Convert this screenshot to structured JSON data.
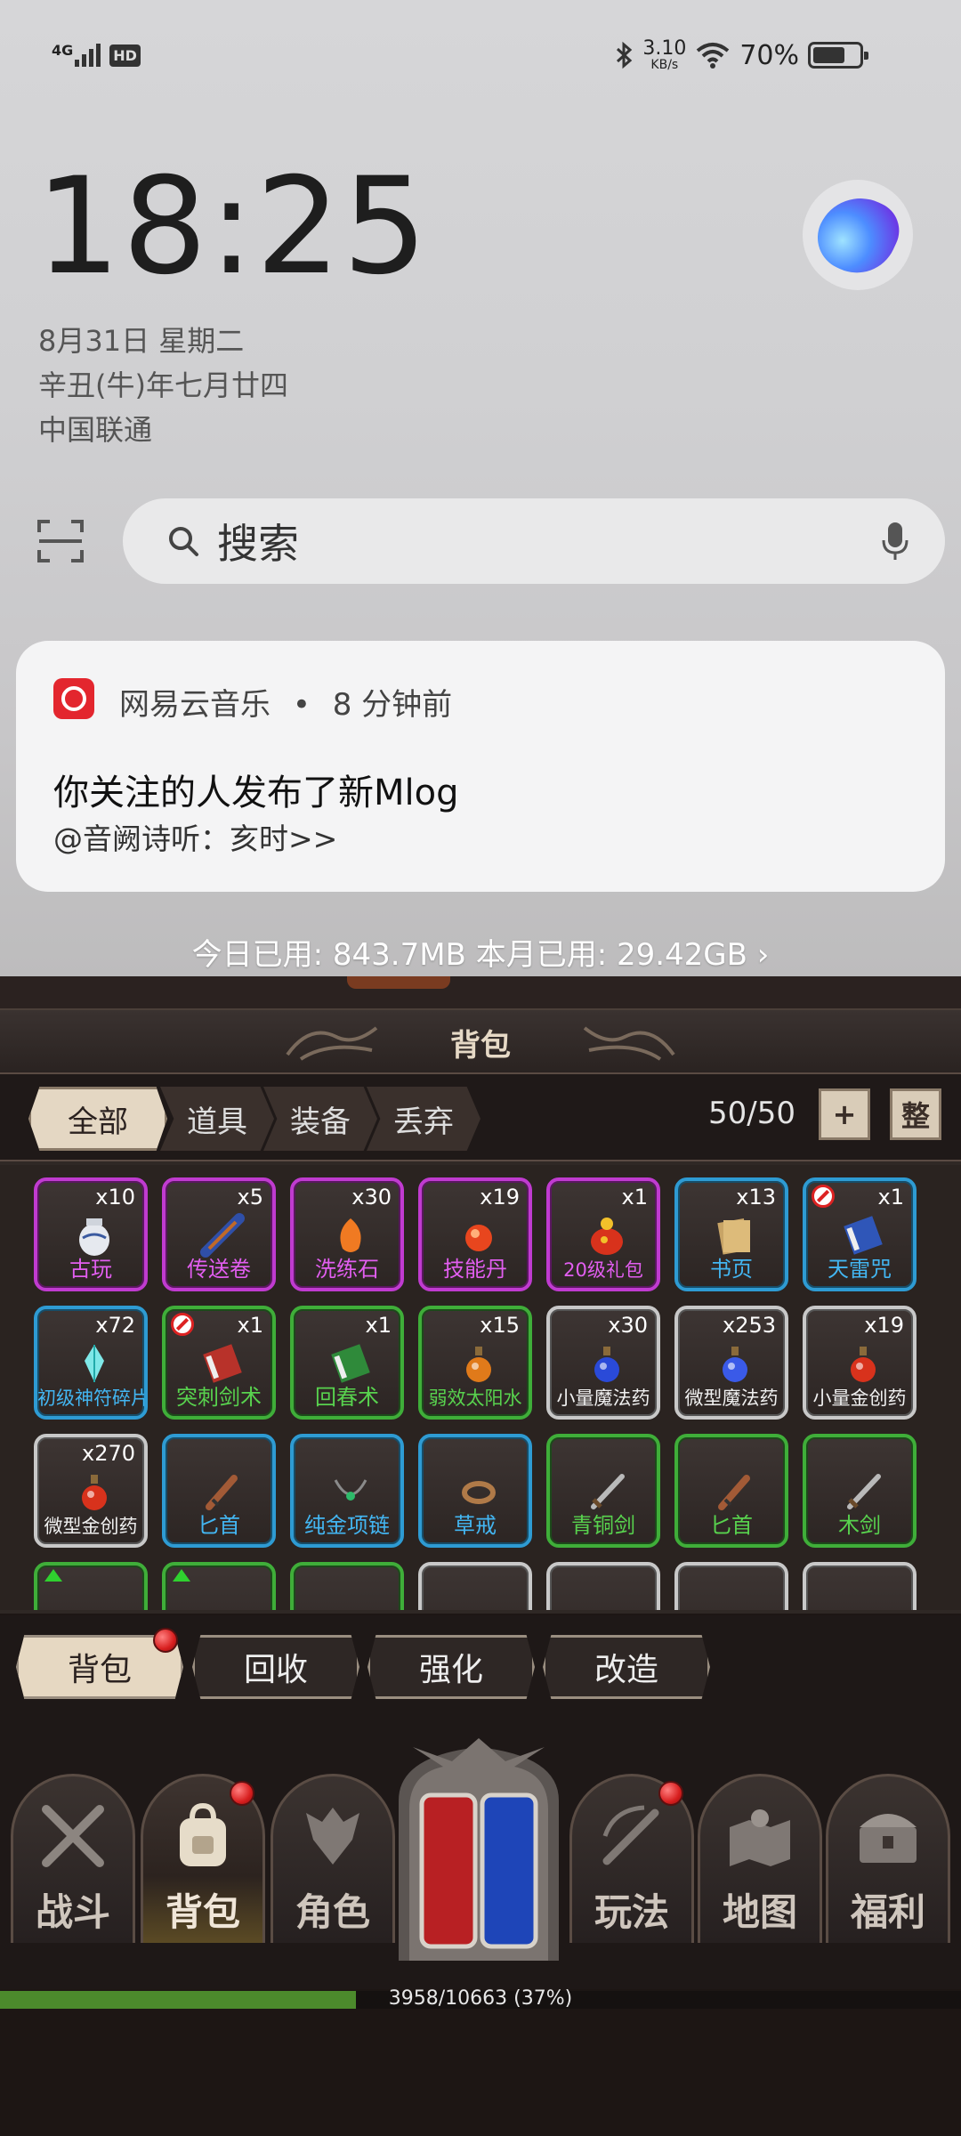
{
  "status_bar": {
    "network": "4G",
    "hd": "HD",
    "speed_value": "3.10",
    "speed_unit": "KB/s",
    "battery": "70%",
    "battery_level": 0.7
  },
  "lockscreen": {
    "time": "18:25",
    "date": "8月31日 星期二",
    "lunar": "辛丑(牛)年七月廿四",
    "carrier": "中国联通"
  },
  "search": {
    "placeholder": "搜索"
  },
  "notification": {
    "app": "网易云音乐",
    "time_ago": "8 分钟前",
    "title": "你关注的人发布了新Mlog",
    "body": "@音阙诗听：亥时>>"
  },
  "data_usage": "今日已用: 843.7MB 本月已用: 29.42GB ›",
  "game": {
    "panel_title": "背包",
    "tabs": [
      "全部",
      "道具",
      "装备",
      "丢弃"
    ],
    "capacity": "50/50",
    "add_btn": "+",
    "sort_btn": "整",
    "items": [
      {
        "count": "x10",
        "name": "古玩",
        "rarity": "purple",
        "icon": "vase-icon"
      },
      {
        "count": "x5",
        "name": "传送卷",
        "rarity": "purple",
        "icon": "scroll-icon"
      },
      {
        "count": "x30",
        "name": "洗练石",
        "rarity": "purple",
        "icon": "stone-icon"
      },
      {
        "count": "x19",
        "name": "技能丹",
        "rarity": "purple",
        "icon": "pill-icon"
      },
      {
        "count": "x1",
        "name": "20级礼包",
        "rarity": "purple",
        "icon": "gift-bag-icon"
      },
      {
        "count": "x13",
        "name": "书页",
        "rarity": "blue",
        "icon": "pages-icon"
      },
      {
        "count": "x1",
        "name": "天雷咒",
        "rarity": "blue",
        "icon": "book-icon",
        "locked": true
      },
      {
        "count": "x72",
        "name": "初级神符碎片",
        "rarity": "blue",
        "icon": "crystal-icon"
      },
      {
        "count": "x1",
        "name": "突刺剑术",
        "rarity": "green",
        "icon": "book-icon",
        "locked": true
      },
      {
        "count": "x1",
        "name": "回春术",
        "rarity": "green",
        "icon": "book-icon"
      },
      {
        "count": "x15",
        "name": "弱效太阳水",
        "rarity": "green",
        "icon": "potion-icon"
      },
      {
        "count": "x30",
        "name": "小量魔法药",
        "rarity": "gray",
        "icon": "potion-icon"
      },
      {
        "count": "x253",
        "name": "微型魔法药",
        "rarity": "gray",
        "icon": "potion-icon"
      },
      {
        "count": "x19",
        "name": "小量金创药",
        "rarity": "gray",
        "icon": "potion-icon"
      },
      {
        "count": "x270",
        "name": "微型金创药",
        "rarity": "gray",
        "icon": "potion-icon"
      },
      {
        "count": "",
        "name": "匕首",
        "rarity": "blue",
        "icon": "dagger-icon"
      },
      {
        "count": "",
        "name": "纯金项链",
        "rarity": "blue",
        "icon": "necklace-icon"
      },
      {
        "count": "",
        "name": "草戒",
        "rarity": "blue",
        "icon": "ring-icon"
      },
      {
        "count": "",
        "name": "青铜剑",
        "rarity": "green",
        "icon": "sword-icon"
      },
      {
        "count": "",
        "name": "匕首",
        "rarity": "green",
        "icon": "dagger-icon"
      },
      {
        "count": "",
        "name": "木剑",
        "rarity": "green",
        "icon": "sword-icon"
      }
    ],
    "subtabs": [
      "背包",
      "回收",
      "强化",
      "改造"
    ],
    "nav": [
      "战斗",
      "背包",
      "角色",
      "玩法",
      "地图",
      "福利"
    ],
    "exp_text": "3958/10663 (37%)",
    "exp_fraction": 0.37
  },
  "colors": {
    "purple": "#c03bd0",
    "blue": "#2e9bd3",
    "green": "#3fae39",
    "gray": "#c8c8c8"
  }
}
